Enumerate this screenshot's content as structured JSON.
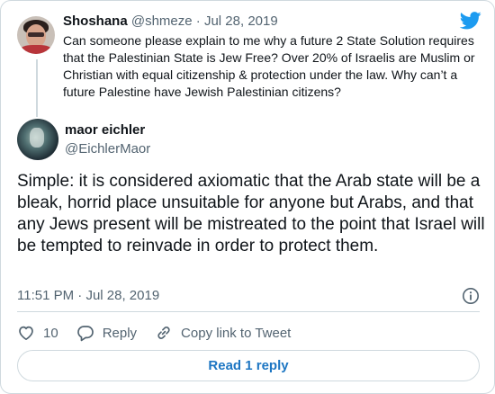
{
  "parent_tweet": {
    "display_name": "Shoshana",
    "handle": "@shmeze",
    "separator": "·",
    "date": "Jul 28, 2019",
    "text": "Can someone please explain to me why a future 2 State Solution requires that the Palestinian State is Jew Free? Over 20% of Israelis are Muslim or Christian with equal citizenship & protection under the law. Why can’t a future Palestine have Jewish Palestinian citizens?"
  },
  "main_tweet": {
    "display_name": "maor eichler",
    "handle": "@EichlerMaor",
    "text": "Simple: it is considered axiomatic that the Arab state will be a bleak, horrid place unsuitable for anyone but Arabs, and that any Jews present will be mistreated to the point that Israel will be tempted to reinvade in order to protect them.",
    "time": "11:51 PM",
    "separator": "·",
    "date": "Jul 28, 2019"
  },
  "actions": {
    "like_count": "10",
    "reply_label": "Reply",
    "copy_link_label": "Copy link to Tweet"
  },
  "read_replies_label": "Read 1 reply",
  "colors": {
    "brand": "#1d9bf0",
    "link": "#1d76c3",
    "muted": "#536471",
    "border": "#cfd9de"
  }
}
